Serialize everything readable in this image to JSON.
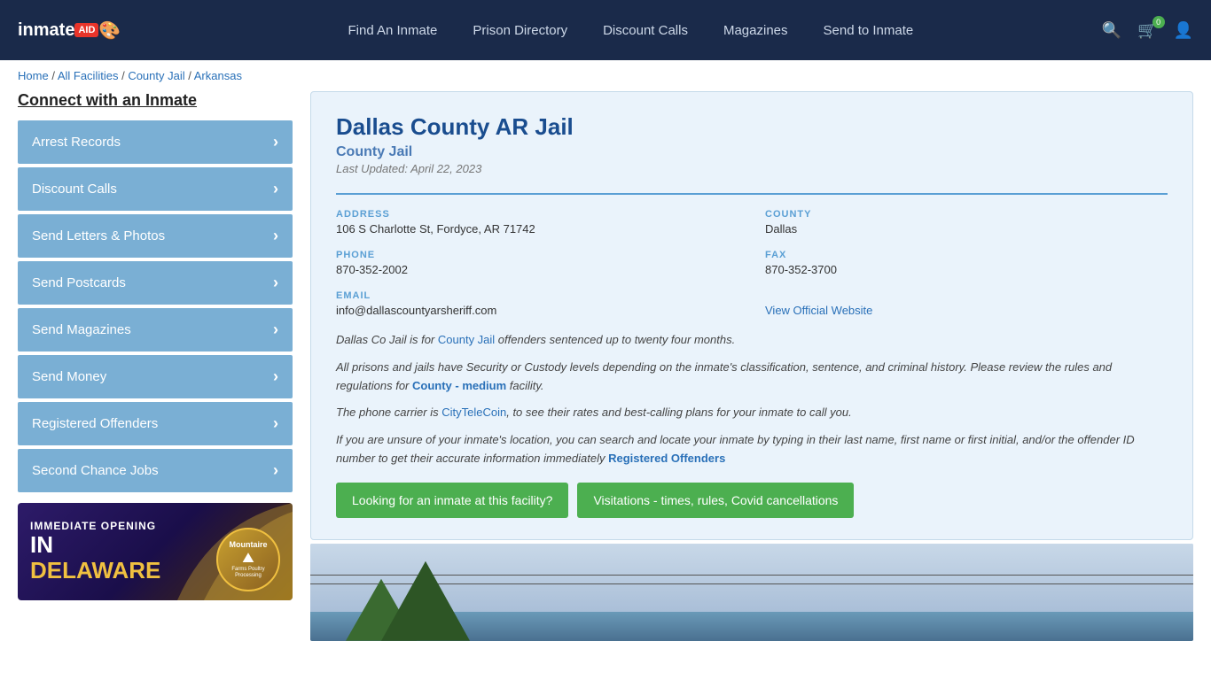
{
  "header": {
    "logo": "inmateAID",
    "logo_badge": "AID",
    "nav": [
      {
        "id": "find-inmate",
        "label": "Find An Inmate"
      },
      {
        "id": "prison-directory",
        "label": "Prison Directory"
      },
      {
        "id": "discount-calls",
        "label": "Discount Calls"
      },
      {
        "id": "magazines",
        "label": "Magazines"
      },
      {
        "id": "send-to-inmate",
        "label": "Send to Inmate",
        "has_dropdown": true
      }
    ],
    "cart_count": "0"
  },
  "breadcrumb": {
    "home": "Home",
    "all_facilities": "All Facilities",
    "county_jail": "County Jail",
    "state": "Arkansas"
  },
  "sidebar": {
    "title": "Connect with an Inmate",
    "items": [
      {
        "id": "arrest-records",
        "label": "Arrest Records"
      },
      {
        "id": "discount-calls",
        "label": "Discount Calls"
      },
      {
        "id": "send-letters",
        "label": "Send Letters & Photos"
      },
      {
        "id": "send-postcards",
        "label": "Send Postcards"
      },
      {
        "id": "send-magazines",
        "label": "Send Magazines"
      },
      {
        "id": "send-money",
        "label": "Send Money"
      },
      {
        "id": "registered-offenders",
        "label": "Registered Offenders"
      },
      {
        "id": "second-chance-jobs",
        "label": "Second Chance Jobs"
      }
    ]
  },
  "ad": {
    "immediate": "IMMEDIATE OPENING",
    "in": "IN",
    "delaware": "DELAWARE",
    "logo_name": "Mountaire",
    "logo_sub": "Farms Poultry Processing"
  },
  "facility": {
    "name": "Dallas County AR Jail",
    "type": "County Jail",
    "last_updated": "Last Updated: April 22, 2023",
    "address_label": "ADDRESS",
    "address": "106 S Charlotte St, Fordyce, AR 71742",
    "county_label": "COUNTY",
    "county": "Dallas",
    "phone_label": "PHONE",
    "phone": "870-352-2002",
    "fax_label": "FAX",
    "fax": "870-352-3700",
    "email_label": "EMAIL",
    "email": "info@dallascountyarsheriff.com",
    "website_label": "View Official Website",
    "desc1": "Dallas Co Jail is for County Jail offenders sentenced up to twenty four months.",
    "desc2": "All prisons and jails have Security or Custody levels depending on the inmate's classification, sentence, and criminal history. Please review the rules and regulations for County - medium facility.",
    "desc3": "The phone carrier is CityTeleCoin, to see their rates and best-calling plans for your inmate to call you.",
    "desc4": "If you are unsure of your inmate's location, you can search and locate your inmate by typing in their last name, first name or first initial, and/or the offender ID number to get their accurate information immediately Registered Offenders",
    "btn_find_inmate": "Looking for an inmate at this facility?",
    "btn_visitations": "Visitations - times, rules, Covid cancellations"
  }
}
